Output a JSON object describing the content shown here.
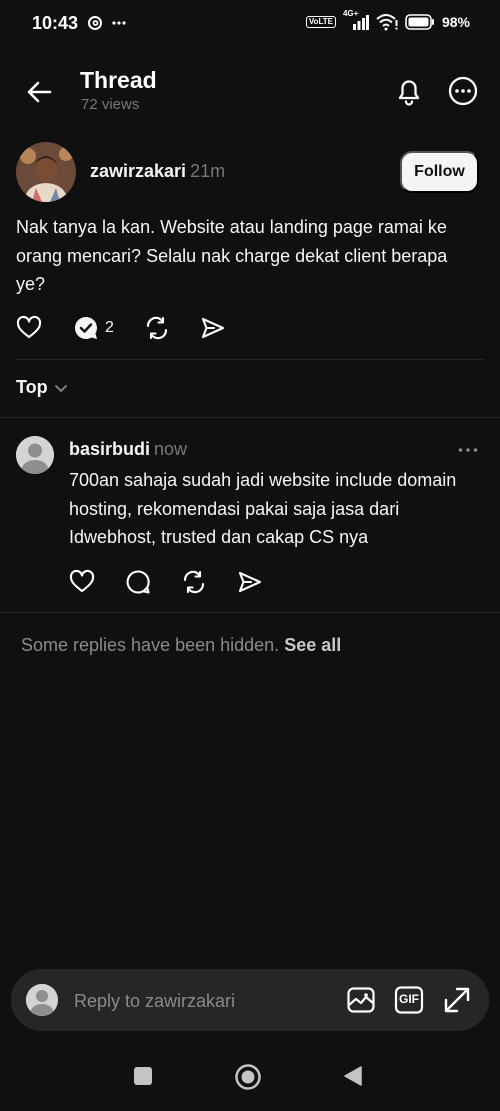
{
  "status_bar": {
    "time": "10:43",
    "volte": "Vo\nLTE",
    "network": "4G+",
    "battery": "98%"
  },
  "header": {
    "title": "Thread",
    "views": "72 views"
  },
  "post": {
    "author": "zawirzakari",
    "time": "21m",
    "follow_label": "Follow",
    "text": "Nak tanya la kan. Website atau landing page ramai ke orang mencari? Selalu nak charge dekat client berapa ye?",
    "reply_count": "2"
  },
  "sort": {
    "label": "Top"
  },
  "reply": {
    "author": "basirbudi",
    "time": "now",
    "text": "700an sahaja sudah jadi website  include domain hosting, rekomendasi pakai saja jasa dari Idwebhost, trusted dan cakap CS nya"
  },
  "hidden_note": {
    "text": "Some replies have been hidden.",
    "link": "See all"
  },
  "composer": {
    "placeholder": "Reply to zawirzakari",
    "gif_label": "GIF"
  },
  "colors": {
    "background": "#101010",
    "text": "#f3f5f7",
    "muted": "#777777",
    "divider": "#262626",
    "composer_bg": "#262626"
  }
}
